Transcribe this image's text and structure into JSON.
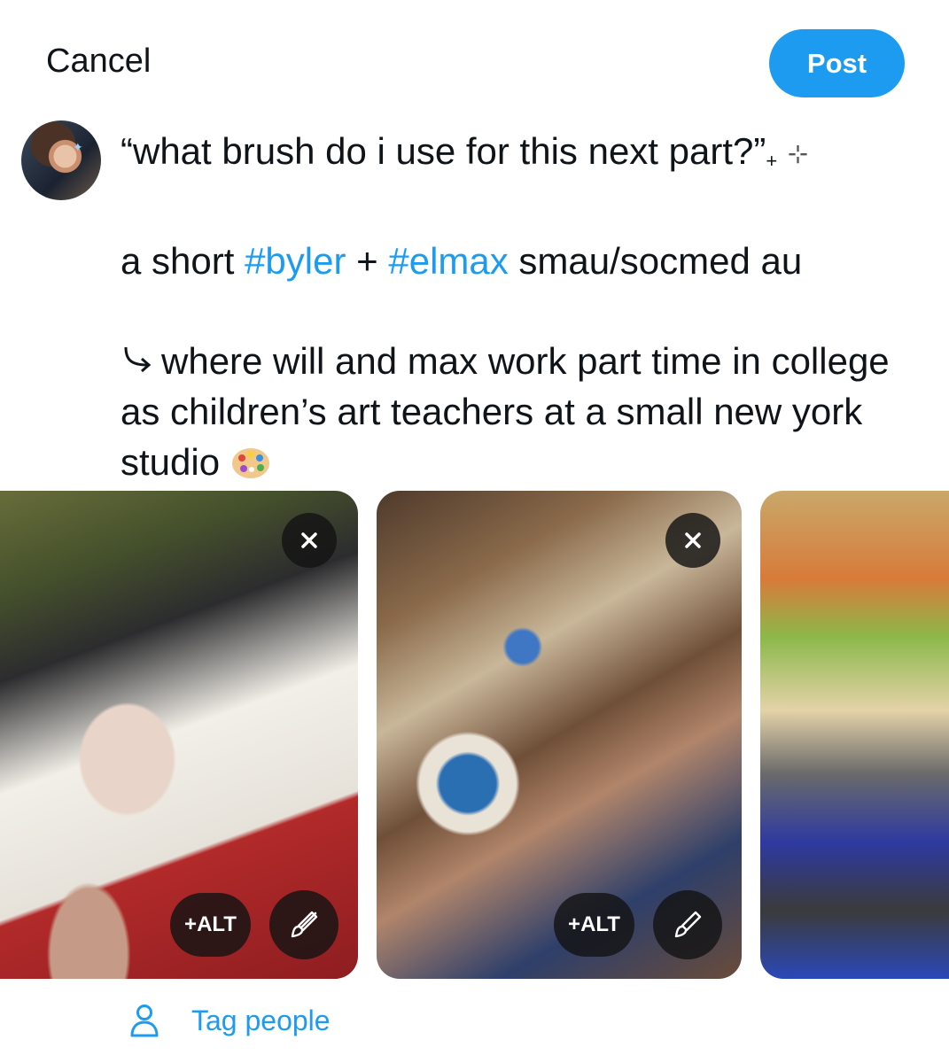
{
  "header": {
    "cancel_label": "Cancel",
    "post_label": "Post"
  },
  "composer": {
    "line1_text": "“what brush do i use for this next part?”",
    "line1_plus": "+",
    "line1_sparkle": "⊹",
    "line2_prefix": "a short ",
    "line2_hashtag1": "#byler",
    "line2_mid": " + ",
    "line2_hashtag2": "#elmax",
    "line2_suffix": " smau/socmed au",
    "line3_text": "where will and max work part time in college as children’s art teachers at a small new york studio",
    "emoji": "palette-emoji"
  },
  "media": [
    {
      "alt_label": "+ALT",
      "icons": [
        "close-icon",
        "brush-icon"
      ]
    },
    {
      "alt_label": "+ALT",
      "icons": [
        "close-icon",
        "brush-icon"
      ]
    },
    {
      "alt_label": "",
      "icons": []
    }
  ],
  "footer": {
    "tag_people_label": "Tag people",
    "icon": "person-icon"
  },
  "colors": {
    "accent": "#1d9bf0",
    "text": "#0f1419",
    "overlay": "#141414"
  }
}
